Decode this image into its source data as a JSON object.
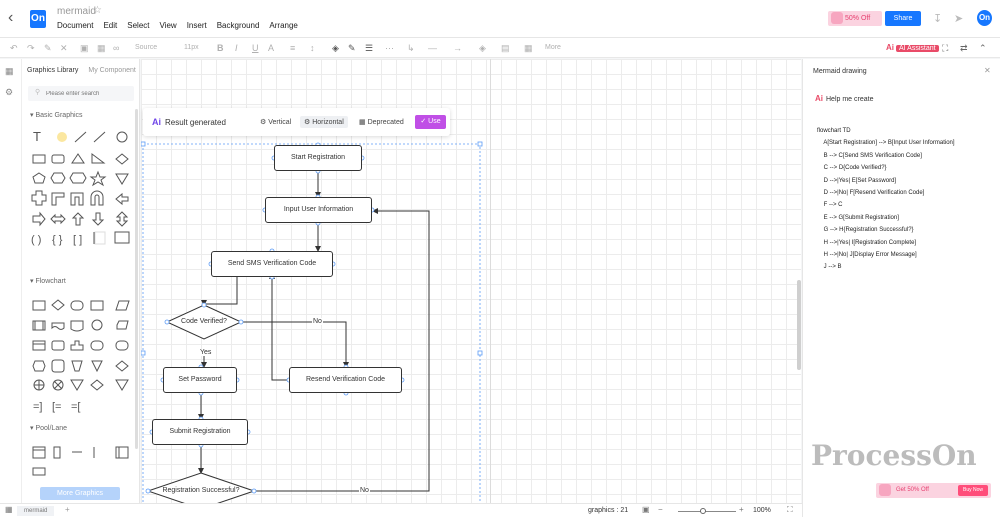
{
  "header": {
    "doc_name": "mermaid",
    "menu": [
      "Document",
      "Edit",
      "Select",
      "View",
      "Insert",
      "Background",
      "Arrange"
    ],
    "promo": "50% Off",
    "share": "Share",
    "avatar": "On"
  },
  "toolbar": {
    "font": "Source",
    "font_size": "11px",
    "more": "More",
    "ai_assistant": "AI Assistant"
  },
  "left_panel": {
    "tabs": [
      "Graphics Library",
      "My Component"
    ],
    "search_placeholder": "Please enter search",
    "sections": [
      "Basic Graphics",
      "Flowchart",
      "Pool/Lane"
    ],
    "more_graphics": "More Graphics"
  },
  "result_bar": {
    "title": "Result generated",
    "vertical": "Vertical",
    "horizontal": "Horizontal",
    "deprecated": "Deprecated",
    "use": "Use"
  },
  "flow": {
    "nodes": {
      "a": "Start Registration",
      "b": "Input User Information",
      "c": "Send SMS Verification Code",
      "d": "Code Verified?",
      "e": "Set Password",
      "f": "Resend Verification Code",
      "g": "Submit Registration",
      "h": "Registration Successful?"
    },
    "edge_labels": {
      "yes": "Yes",
      "no1": "No",
      "no2": "No"
    }
  },
  "right_panel": {
    "title": "Mermaid drawing",
    "help": "Help me create",
    "code": "flowchart TD\n    A[Start Registration] --> B[Input User Information]\n    B --> C[Send SMS Verification Code]\n    C --> D{Code Verified?}\n    D -->|Yes| E[Set Password]\n    D -->|No| F[Resend Verification Code]\n    F --> C\n    E --> G[Submit Registration]\n    G --> H{Registration Successful?}\n    H -->|Yes| I[Registration Complete]\n    H -->|No| J[Display Error Message]\n    J --> B",
    "watermark": "ProcessOn",
    "promo": "Get 50% Off",
    "buy": "Buy Now"
  },
  "bottom": {
    "page_tab": "mermaid",
    "graphics_label": "graphics :",
    "graphics_count": "21",
    "zoom": "100%"
  }
}
